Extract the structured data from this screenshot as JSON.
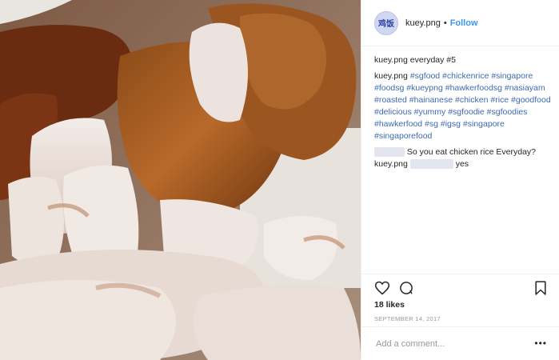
{
  "post": {
    "username": "kuey.png",
    "avatar_text": "鸡饭",
    "separator": "•",
    "follow_label": "Follow"
  },
  "caption": {
    "username": "kuey.png",
    "title": "everyday #5",
    "tags_text": "#sgfood #chickenrice #singapore #foodsg #kueypng #hawkerfoodsg #nasiayam #roasted #hainanese #chicken #rice #goodfood #delicious #yummy #sgfoodie #sgfoodies #hawkerfood #sg #igsg #singapore #singaporefood"
  },
  "comments": [
    {
      "text": "So you eat chicken rice Everyday?"
    },
    {
      "username": "kuey.png",
      "text": "yes"
    }
  ],
  "likes": "18 likes",
  "date": "SEPTEMBER 14, 2017",
  "add_comment": {
    "placeholder": "Add a comment..."
  },
  "more_label": "•••",
  "icons": {
    "like": "heart-icon",
    "comment": "comment-icon",
    "save": "bookmark-icon"
  }
}
